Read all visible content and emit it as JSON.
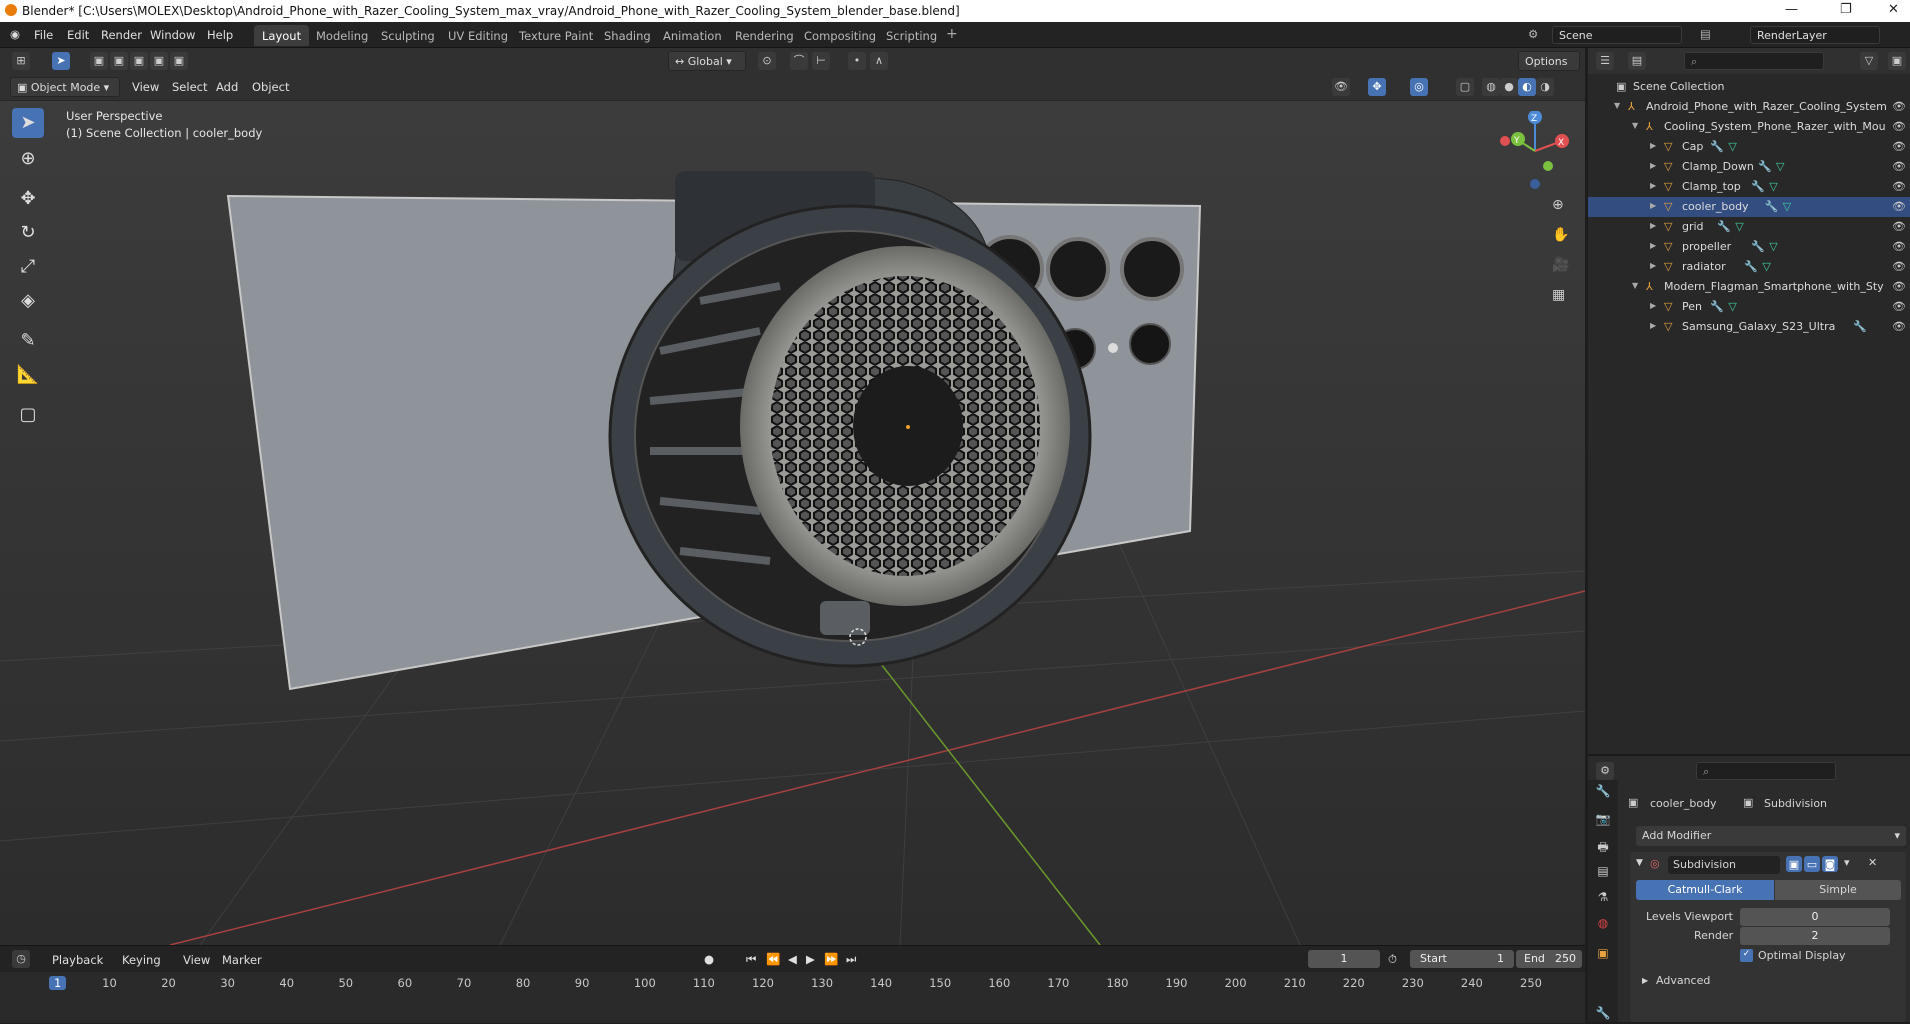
{
  "window": {
    "title": "Blender* [C:\\Users\\MOLEX\\Desktop\\Android_Phone_with_Razer_Cooling_System_max_vray/Android_Phone_with_Razer_Cooling_System_blender_base.blend]"
  },
  "menu": [
    "File",
    "Edit",
    "Render",
    "Window",
    "Help"
  ],
  "workspaces": [
    "Layout",
    "Modeling",
    "Sculpting",
    "UV Editing",
    "Texture Paint",
    "Shading",
    "Animation",
    "Rendering",
    "Compositing",
    "Scripting"
  ],
  "scene": {
    "name": "Scene",
    "render_layer": "RenderLayer"
  },
  "viewport": {
    "mode": "Object Mode",
    "menus": [
      "View",
      "Select",
      "Add",
      "Object"
    ],
    "transform": "Global",
    "options": "Options",
    "info_line1": "User Perspective",
    "info_line2": "(1) Scene Collection | cooler_body",
    "axes": {
      "x": "X",
      "y": "Y",
      "z": "Z"
    }
  },
  "outliner": {
    "root": "Scene Collection",
    "items": [
      {
        "label": "Android_Phone_with_Razer_Cooling_System",
        "depth": 0,
        "type": "collection"
      },
      {
        "label": "Cooling_System_Phone_Razer_with_Mou",
        "depth": 1,
        "type": "collection"
      },
      {
        "label": "Cap",
        "depth": 2,
        "type": "object"
      },
      {
        "label": "Clamp_Down",
        "depth": 2,
        "type": "object"
      },
      {
        "label": "Clamp_top",
        "depth": 2,
        "type": "object"
      },
      {
        "label": "cooler_body",
        "depth": 2,
        "type": "object"
      },
      {
        "label": "grid",
        "depth": 2,
        "type": "object"
      },
      {
        "label": "propeller",
        "depth": 2,
        "type": "object"
      },
      {
        "label": "radiator",
        "depth": 2,
        "type": "object"
      },
      {
        "label": "Modern_Flagman_Smartphone_with_Sty",
        "depth": 1,
        "type": "collection"
      },
      {
        "label": "Pen",
        "depth": 2,
        "type": "object"
      },
      {
        "label": "Samsung_Galaxy_S23_Ultra",
        "depth": 2,
        "type": "object"
      }
    ]
  },
  "properties": {
    "object": "cooler_body",
    "modifier_tab": "Subdivision",
    "add_modifier": "Add Modifier",
    "modifier_name": "Subdivision",
    "type_a": "Catmull-Clark",
    "type_b": "Simple",
    "levels_viewport_label": "Levels Viewport",
    "levels_viewport": "0",
    "render_label": "Render",
    "render": "2",
    "optimal_display": "Optimal Display",
    "advanced": "Advanced"
  },
  "timeline": {
    "menus": [
      "Playback",
      "Keying",
      "View",
      "Marker"
    ],
    "current_frame": "1",
    "start_label": "Start",
    "start": "1",
    "end_label": "End",
    "end": "250",
    "ticks": [
      "1",
      "10",
      "20",
      "30",
      "40",
      "50",
      "60",
      "70",
      "80",
      "90",
      "100",
      "110",
      "120",
      "130",
      "140",
      "150",
      "160",
      "170",
      "180",
      "190",
      "200",
      "210",
      "220",
      "230",
      "240",
      "250"
    ]
  }
}
